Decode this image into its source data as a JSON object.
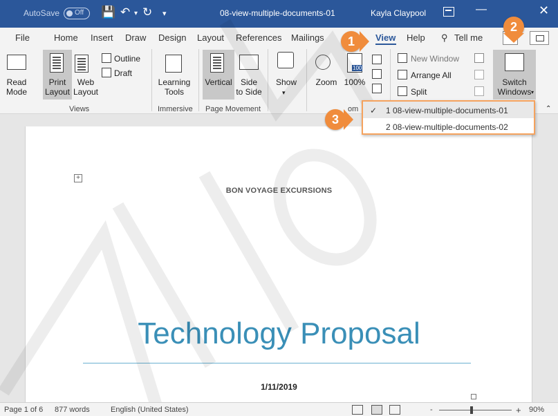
{
  "titlebar": {
    "autosave_label": "AutoSave",
    "autosave_state": "Off",
    "document_title": "08-view-multiple-documents-01",
    "user_name": "Kayla Claypool"
  },
  "tabs": {
    "file": "File",
    "home": "Home",
    "insert": "Insert",
    "draw": "Draw",
    "design": "Design",
    "layout": "Layout",
    "references": "References",
    "mailings": "Mailings",
    "view": "View",
    "help": "Help",
    "tell_me": "Tell me"
  },
  "ribbon": {
    "views": {
      "label": "Views",
      "read_mode": [
        "Read",
        "Mode"
      ],
      "print_layout": [
        "Print",
        "Layout"
      ],
      "web_layout": [
        "Web",
        "Layout"
      ],
      "outline": "Outline",
      "draft": "Draft"
    },
    "immersive": {
      "label": "Immersive",
      "learning_tools": [
        "Learning",
        "Tools"
      ]
    },
    "page_movement": {
      "label": "Page Movement",
      "vertical": "Vertical",
      "side_to_side": [
        "Side",
        "to Side"
      ]
    },
    "show": {
      "label": "Show"
    },
    "zoom": {
      "label": "om",
      "zoom": "Zoom",
      "pct": "100%",
      "hundred_badge": "100"
    },
    "window": {
      "new_window": "New Window",
      "arrange_all": "Arrange All",
      "split": "Split",
      "switch_windows": [
        "Switch",
        "Windows"
      ]
    }
  },
  "switch_menu": {
    "items": [
      {
        "label": "1 08-view-multiple-documents-01",
        "checked": true
      },
      {
        "label": "2 08-view-multiple-documents-02",
        "checked": false
      }
    ]
  },
  "callouts": [
    "1",
    "2",
    "3"
  ],
  "document": {
    "company": "BON VOYAGE EXCURSIONS",
    "title": "Technology Proposal",
    "date": "1/11/2019"
  },
  "statusbar": {
    "page": "Page 1 of 6",
    "words": "877 words",
    "language": "English (United States)",
    "zoom_minus": "-",
    "zoom_plus": "+",
    "zoom_pct": "90%"
  },
  "colors": {
    "title_bar": "#2b579a",
    "callout": "#f08c3c",
    "heading": "#3a8fb7"
  }
}
